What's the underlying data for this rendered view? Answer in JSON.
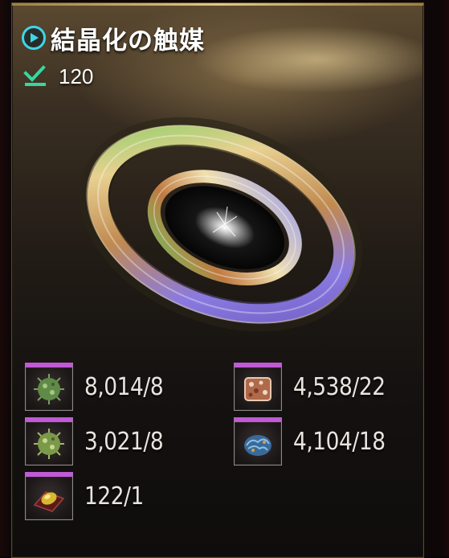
{
  "item": {
    "title": "結晶化の触媒",
    "owned_count": "120",
    "icons": {
      "title_icon": "play-circle-icon",
      "owned_icon": "checkbox-owned-icon",
      "item_image": "crystallization-catalyst-ring-icon"
    }
  },
  "materials": [
    {
      "name_icon": "green-virus-icon",
      "count": "8,014/8"
    },
    {
      "name_icon": "meat-block-icon",
      "count": "4,538/22"
    },
    {
      "name_icon": "green-virus-icon",
      "count": "3,021/8"
    },
    {
      "name_icon": "blue-brain-icon",
      "count": "4,104/18"
    },
    {
      "name_icon": "gold-fruit-plate-icon",
      "count": "122/1"
    }
  ],
  "colors": {
    "accent_cyan": "#3fd6e8",
    "accent_green": "#34d8a0",
    "slot_top_purple": "#c05ad6",
    "frame_gold": "#e2c880"
  }
}
